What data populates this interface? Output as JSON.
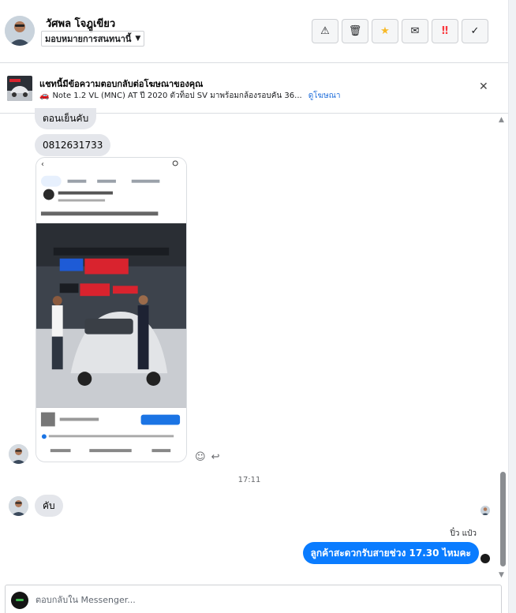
{
  "header": {
    "customer_name": "วัศพล โจฎูเขียว",
    "assign_label": "มอบหมายการสนทนานี้",
    "actions": [
      {
        "name": "report-spam-button",
        "icon": "warning-triangle-icon",
        "glyph": "⚠"
      },
      {
        "name": "delete-button",
        "icon": "trash-icon",
        "glyph": "🗑"
      },
      {
        "name": "star-button",
        "icon": "star-icon",
        "glyph": "★"
      },
      {
        "name": "mark-unread-button",
        "icon": "envelope-icon",
        "glyph": "✉"
      },
      {
        "name": "follow-up-button",
        "icon": "double-exclamation-icon",
        "glyph": "‼"
      },
      {
        "name": "mark-done-button",
        "icon": "check-icon",
        "glyph": "✓"
      }
    ]
  },
  "banner": {
    "title": "แชทนี้มีข้อความตอบกลับต่อโฆษณาของคุณ",
    "ad_text": "Note 1.2 VL (MNC) AT ปี 2020 ตัวท็อป SV มาพร้อมกล้องรอบคัน 36...",
    "ad_link": "ดูโฆษณา",
    "close_icon": "close-icon"
  },
  "messages": {
    "incoming_1": "ตอนเย็นคับ",
    "incoming_2": "0812631733",
    "incoming_3": "คับ",
    "time": "17:11",
    "agent_name": "ปิ๋ว แป๋ว",
    "outgoing_1": "ลูกค้าสะดวกรับสายช่วง 17.30 ไหมคะ"
  },
  "composer": {
    "placeholder": "ตอบกลับใน Messenger..."
  },
  "colors": {
    "outgoing_bubble": "#0a7cff",
    "incoming_bubble": "#e4e6eb",
    "link": "#216fdb",
    "star": "#f7b928"
  }
}
